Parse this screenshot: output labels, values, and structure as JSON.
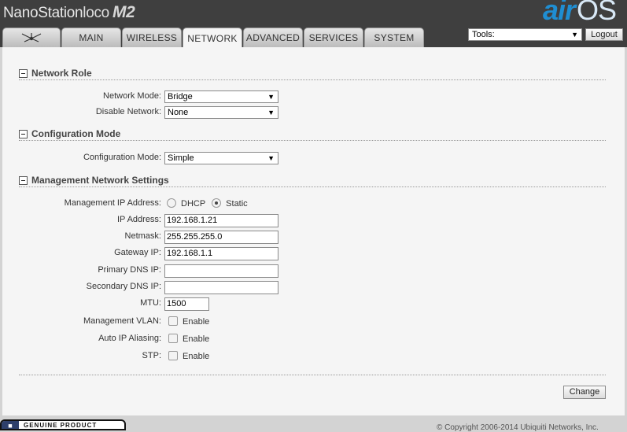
{
  "header": {
    "brand_name": "NanoStation",
    "brand_variant": "loco",
    "brand_model": "M2",
    "airos_air": "air",
    "airos_os": "OS"
  },
  "tabs": [
    {
      "label": "",
      "icon": "ubiquiti-logo-icon"
    },
    {
      "label": "MAIN"
    },
    {
      "label": "WIRELESS"
    },
    {
      "label": "NETWORK",
      "active": true
    },
    {
      "label": "ADVANCED"
    },
    {
      "label": "SERVICES"
    },
    {
      "label": "SYSTEM"
    }
  ],
  "toolbar": {
    "tools_value": "Tools:",
    "logout_label": "Logout"
  },
  "network_role": {
    "title": "Network Role",
    "network_mode_label": "Network Mode:",
    "network_mode_value": "Bridge",
    "disable_network_label": "Disable Network:",
    "disable_network_value": "None"
  },
  "configuration_mode": {
    "title": "Configuration Mode",
    "mode_label": "Configuration Mode:",
    "mode_value": "Simple"
  },
  "management": {
    "title": "Management Network Settings",
    "ip_address_mode_label": "Management IP Address:",
    "dhcp_label": "DHCP",
    "static_label": "Static",
    "ip_mode_selected": "Static",
    "ip_address_label": "IP Address:",
    "ip_address_value": "192.168.1.21",
    "netmask_label": "Netmask:",
    "netmask_value": "255.255.255.0",
    "gateway_label": "Gateway IP:",
    "gateway_value": "192.168.1.1",
    "primary_dns_label": "Primary DNS IP:",
    "primary_dns_value": "",
    "secondary_dns_label": "Secondary DNS IP:",
    "secondary_dns_value": "",
    "mtu_label": "MTU:",
    "mtu_value": "1500",
    "vlan_label": "Management VLAN:",
    "vlan_enable_label": "Enable",
    "alias_label": "Auto IP Aliasing:",
    "alias_enable_label": "Enable",
    "stp_label": "STP:",
    "stp_enable_label": "Enable"
  },
  "actions": {
    "change_label": "Change"
  },
  "footer": {
    "genuine_label": "GENUINE PRODUCT",
    "copyright": "© Copyright 2006-2014 Ubiquiti Networks, Inc."
  }
}
